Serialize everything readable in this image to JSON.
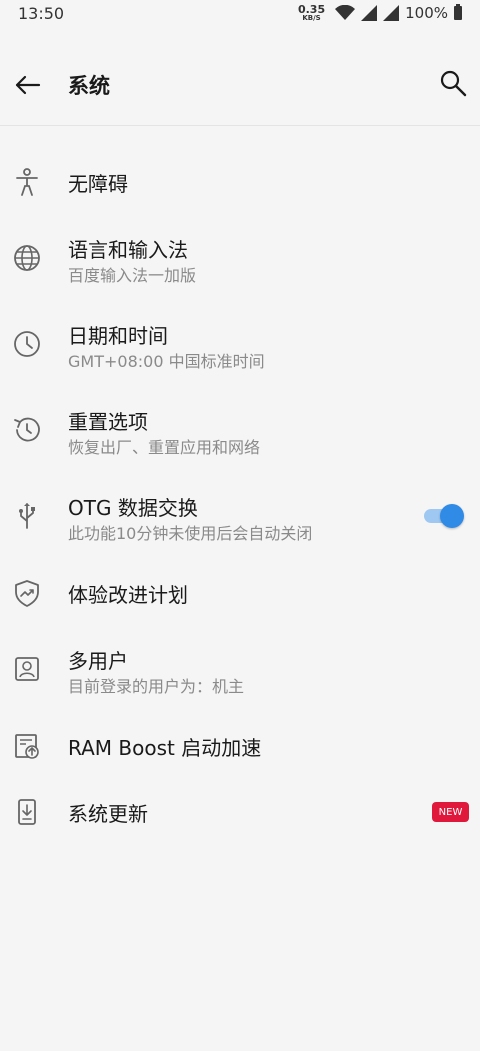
{
  "status": {
    "time": "13:50",
    "speed_value": "0.35",
    "speed_unit": "KB/S",
    "battery": "100%"
  },
  "header": {
    "title": "系统"
  },
  "items": [
    {
      "title": "无障碍",
      "subtitle": "",
      "icon": "accessibility-icon"
    },
    {
      "title": "语言和输入法",
      "subtitle": "百度输入法一加版",
      "icon": "globe-icon"
    },
    {
      "title": "日期和时间",
      "subtitle": "GMT+08:00 中国标准时间",
      "icon": "clock-icon"
    },
    {
      "title": "重置选项",
      "subtitle": "恢复出厂、重置应用和网络",
      "icon": "history-icon"
    },
    {
      "title": "OTG 数据交换",
      "subtitle": "此功能10分钟未使用后会自动关闭",
      "icon": "usb-icon",
      "toggle_on": true
    },
    {
      "title": "体验改进计划",
      "subtitle": "",
      "icon": "shield-trend-icon"
    },
    {
      "title": "多用户",
      "subtitle": "目前登录的用户为：机主",
      "icon": "user-icon"
    },
    {
      "title": "RAM Boost 启动加速",
      "subtitle": "",
      "icon": "ram-boost-icon"
    },
    {
      "title": "系统更新",
      "subtitle": "",
      "icon": "system-update-icon",
      "badge": "NEW"
    }
  ],
  "colors": {
    "accent": "#2f8be6",
    "badge": "#e0183c"
  }
}
